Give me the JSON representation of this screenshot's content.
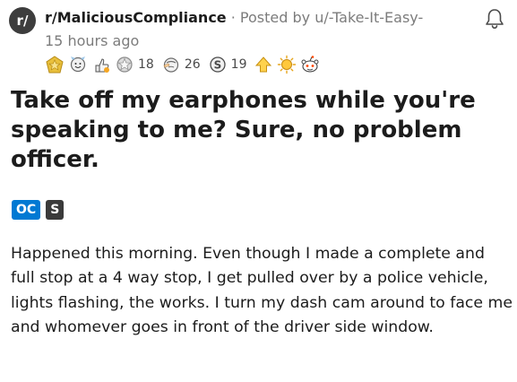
{
  "post": {
    "subreddit_initial": "r/",
    "subreddit": "r/MaliciousCompliance",
    "separator": " · ",
    "posted_by": "Posted by u/-Take-It-Easy-",
    "time": "15 hours ago",
    "awards": [
      {
        "name": "gold-award",
        "count": null
      },
      {
        "name": "wholesome-award",
        "count": null
      },
      {
        "name": "helpful-award",
        "count": null
      },
      {
        "name": "silver-award",
        "count": "18"
      },
      {
        "name": "facepalm-award",
        "count": "26"
      },
      {
        "name": "dollar-award",
        "count": "19"
      },
      {
        "name": "upvote-award",
        "count": null
      },
      {
        "name": "sun-award",
        "count": null
      },
      {
        "name": "snoo-award",
        "count": null
      }
    ],
    "title": "Take off my earphones while you're speaking to me? Sure, no problem officer.",
    "flairs": {
      "oc": "OC",
      "s": "S"
    },
    "body": "Happened this morning. Even though I made a complete and full stop at a 4 way stop, I get pulled over by a police vehicle, lights flashing, the works. I turn my dash cam around to face me and whomever goes in front of the driver side window."
  },
  "colors": {
    "accent": "#0079d3",
    "text": "#1c1c1c",
    "muted": "#7c7c7c"
  }
}
